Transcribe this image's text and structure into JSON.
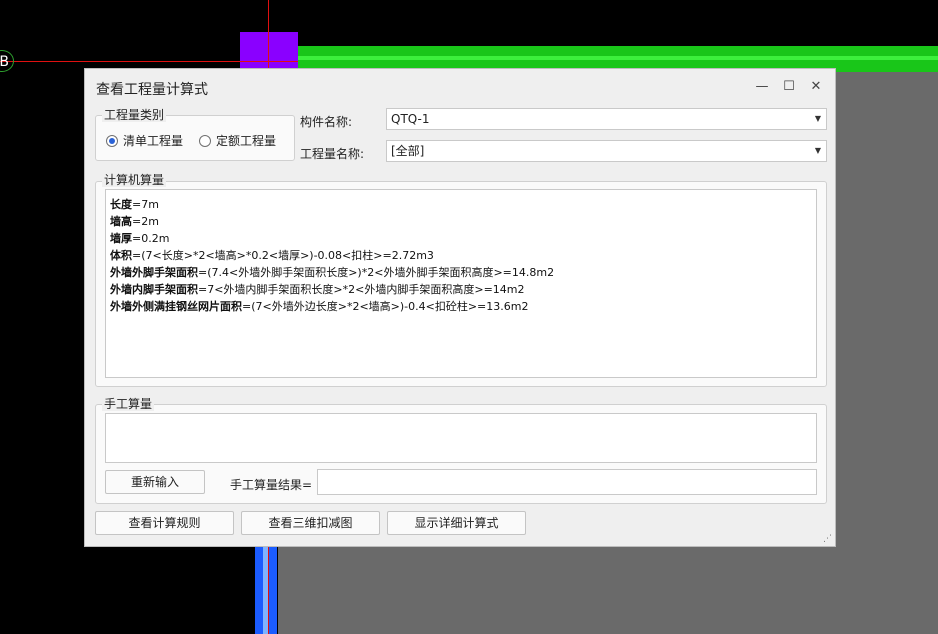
{
  "background": {
    "axis_label": "B"
  },
  "dialog": {
    "title": "查看工程量计算式",
    "controls": {
      "minimize": "—",
      "maximize": "☐",
      "close": "✕"
    },
    "quantity_type": {
      "label": "工程量类别",
      "options": [
        {
          "label": "清单工程量",
          "selected": true
        },
        {
          "label": "定额工程量",
          "selected": false
        }
      ]
    },
    "component_name": {
      "label": "构件名称:",
      "value": "QTQ-1"
    },
    "quantity_name": {
      "label": "工程量名称:",
      "value": "[全部]"
    },
    "computer_calc": {
      "label": "计算机算量",
      "lines": [
        {
          "name": "长度",
          "expr": "=7m"
        },
        {
          "name": "墙高",
          "expr": "=2m"
        },
        {
          "name": "墙厚",
          "expr": "=0.2m"
        },
        {
          "name": "体积",
          "expr": "=(7<长度>*2<墙高>*0.2<墙厚>)-0.08<扣柱>=2.72m3"
        },
        {
          "name": "外墙外脚手架面积",
          "expr": "=(7.4<外墙外脚手架面积长度>)*2<外墙外脚手架面积高度>=14.8m2"
        },
        {
          "name": "外墙内脚手架面积",
          "expr": "=7<外墙内脚手架面积长度>*2<外墙内脚手架面积高度>=14m2"
        },
        {
          "name": "外墙外侧满挂钢丝网片面积",
          "expr": "=(7<外墙外边长度>*2<墙高>)-0.4<扣砼柱>=13.6m2"
        }
      ]
    },
    "manual_calc": {
      "label": "手工算量",
      "reenter_button": "重新输入",
      "result_label": "手工算量结果=",
      "result_value": ""
    },
    "buttons": {
      "view_rules": "查看计算规则",
      "view_3d": "查看三维扣减图",
      "show_detail": "显示详细计算式"
    },
    "grip": "⋰"
  }
}
